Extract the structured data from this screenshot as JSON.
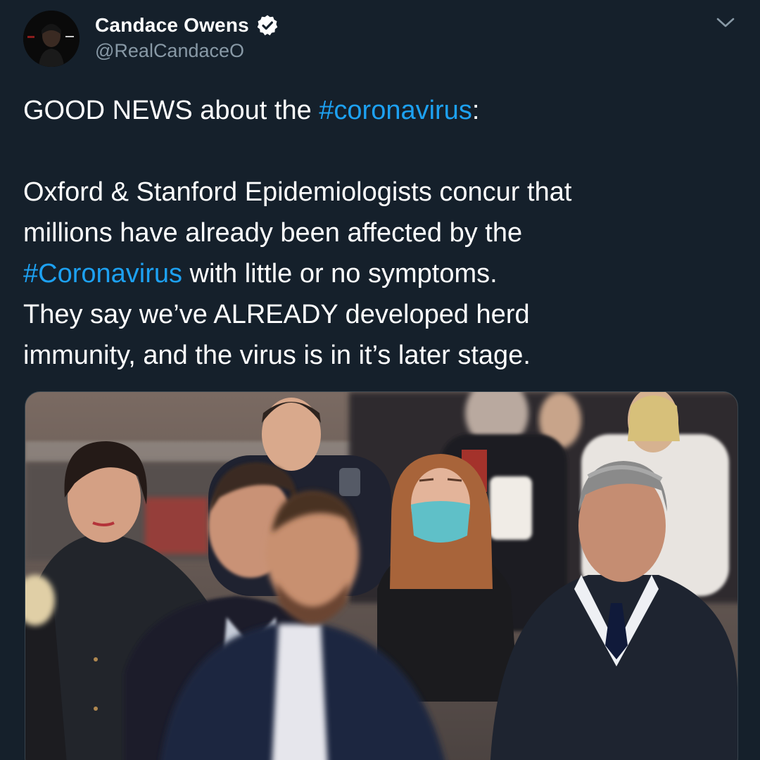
{
  "author": {
    "display_name": "Candace Owens",
    "handle": "@RealCandaceO",
    "verified": true,
    "avatar_icon": "profile-photo"
  },
  "menu": {
    "icon": "chevron-down-icon"
  },
  "tweet": {
    "line1": {
      "before": "GOOD NEWS about the ",
      "hashtag": "#coronavirus",
      "after": ":"
    },
    "line2": "Oxford & Stanford Epidemiologists concur that",
    "line3": "millions have already been affected by the",
    "line4": {
      "hashtag": "#Coronavirus",
      "after": " with little or no symptoms."
    },
    "line5": "They say we’ve ALREADY developed herd",
    "line6": "immunity, and the virus is in it’s later stage."
  },
  "colors": {
    "background": "#15202b",
    "text": "#ffffff",
    "secondary": "#8899a6",
    "link": "#1da1f2",
    "verified_badge": "#ffffff"
  },
  "media": {
    "kind": "photo",
    "subject": "crowd-of-pedestrians"
  }
}
